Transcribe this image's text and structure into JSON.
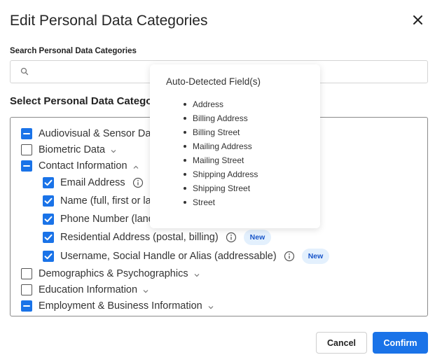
{
  "dialog": {
    "title": "Edit Personal Data Categories",
    "close_icon": "close-icon"
  },
  "search": {
    "label": "Search Personal Data Categories",
    "value": "",
    "placeholder": "",
    "icon": "search-icon"
  },
  "section": {
    "title": "Select Personal Data Categories"
  },
  "categories": [
    {
      "label": "Audiovisual & Sensor Data",
      "state": "indeterminate",
      "level": 0,
      "chevron": "down"
    },
    {
      "label": "Biometric Data",
      "state": "unchecked",
      "level": 0,
      "chevron": "down"
    },
    {
      "label": "Contact Information",
      "state": "indeterminate",
      "level": 0,
      "chevron": "up"
    },
    {
      "label": "Email Address",
      "state": "checked",
      "level": 1,
      "info": true
    },
    {
      "label": "Name (full, first or last)",
      "state": "checked",
      "level": 1
    },
    {
      "label": "Phone Number (landline, mobile)",
      "state": "checked",
      "level": 1
    },
    {
      "label": "Residential Address (postal, billing)",
      "state": "checked",
      "level": 1,
      "info": true,
      "badge": "New"
    },
    {
      "label": "Username, Social Handle or Alias (addressable)",
      "state": "checked",
      "level": 1,
      "info": true,
      "badge": "New"
    },
    {
      "label": "Demographics & Psychographics",
      "state": "unchecked",
      "level": 0,
      "chevron": "down"
    },
    {
      "label": "Education Information",
      "state": "unchecked",
      "level": 0,
      "chevron": "down"
    },
    {
      "label": "Employment & Business Information",
      "state": "indeterminate",
      "level": 0,
      "chevron": "down"
    }
  ],
  "popover": {
    "title": "Auto-Detected Field(s)",
    "items": [
      "Address",
      "Billing Address",
      "Billing Street",
      "Mailing Address",
      "Mailing Street",
      "Shipping Address",
      "Shipping Street",
      "Street"
    ]
  },
  "footer": {
    "cancel_label": "Cancel",
    "confirm_label": "Confirm"
  },
  "colors": {
    "accent": "#1a73e8",
    "badge_bg": "#e3f0fd",
    "badge_text": "#1a56c9"
  }
}
